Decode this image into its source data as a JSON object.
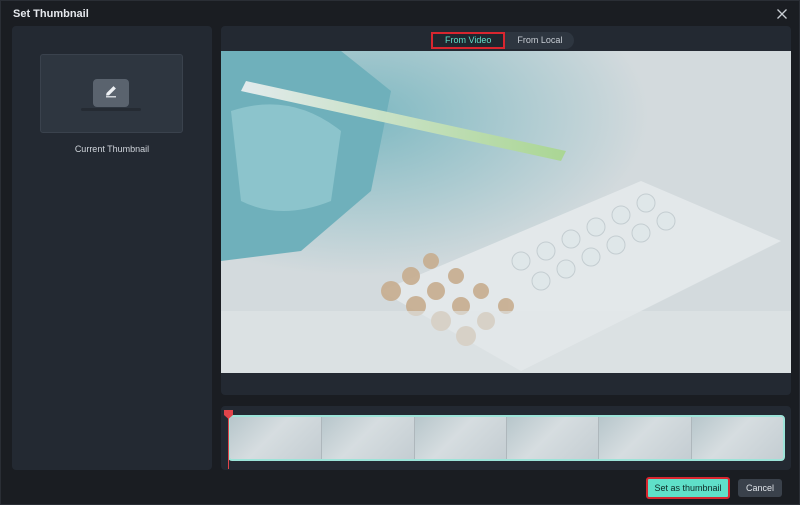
{
  "dialog": {
    "title": "Set Thumbnail",
    "close_icon": "close-icon"
  },
  "left": {
    "thumbnail_label": "Current Thumbnail",
    "edit_icon": "pencil-icon"
  },
  "tabs": [
    {
      "label": "From Video",
      "active": true
    },
    {
      "label": "From Local",
      "active": false
    }
  ],
  "preview": {
    "description_icon": "video-frame-preview"
  },
  "timeline": {
    "frame_count": 6,
    "playhead_color": "#e0444a",
    "strip_border_color": "#9ce3d8"
  },
  "actions": {
    "set_label": "Set as thumbnail",
    "cancel_label": "Cancel"
  },
  "colors": {
    "accent": "#5fe0c9",
    "highlight_border": "#d8262f",
    "panel": "#232932",
    "background": "#1a1d22"
  }
}
